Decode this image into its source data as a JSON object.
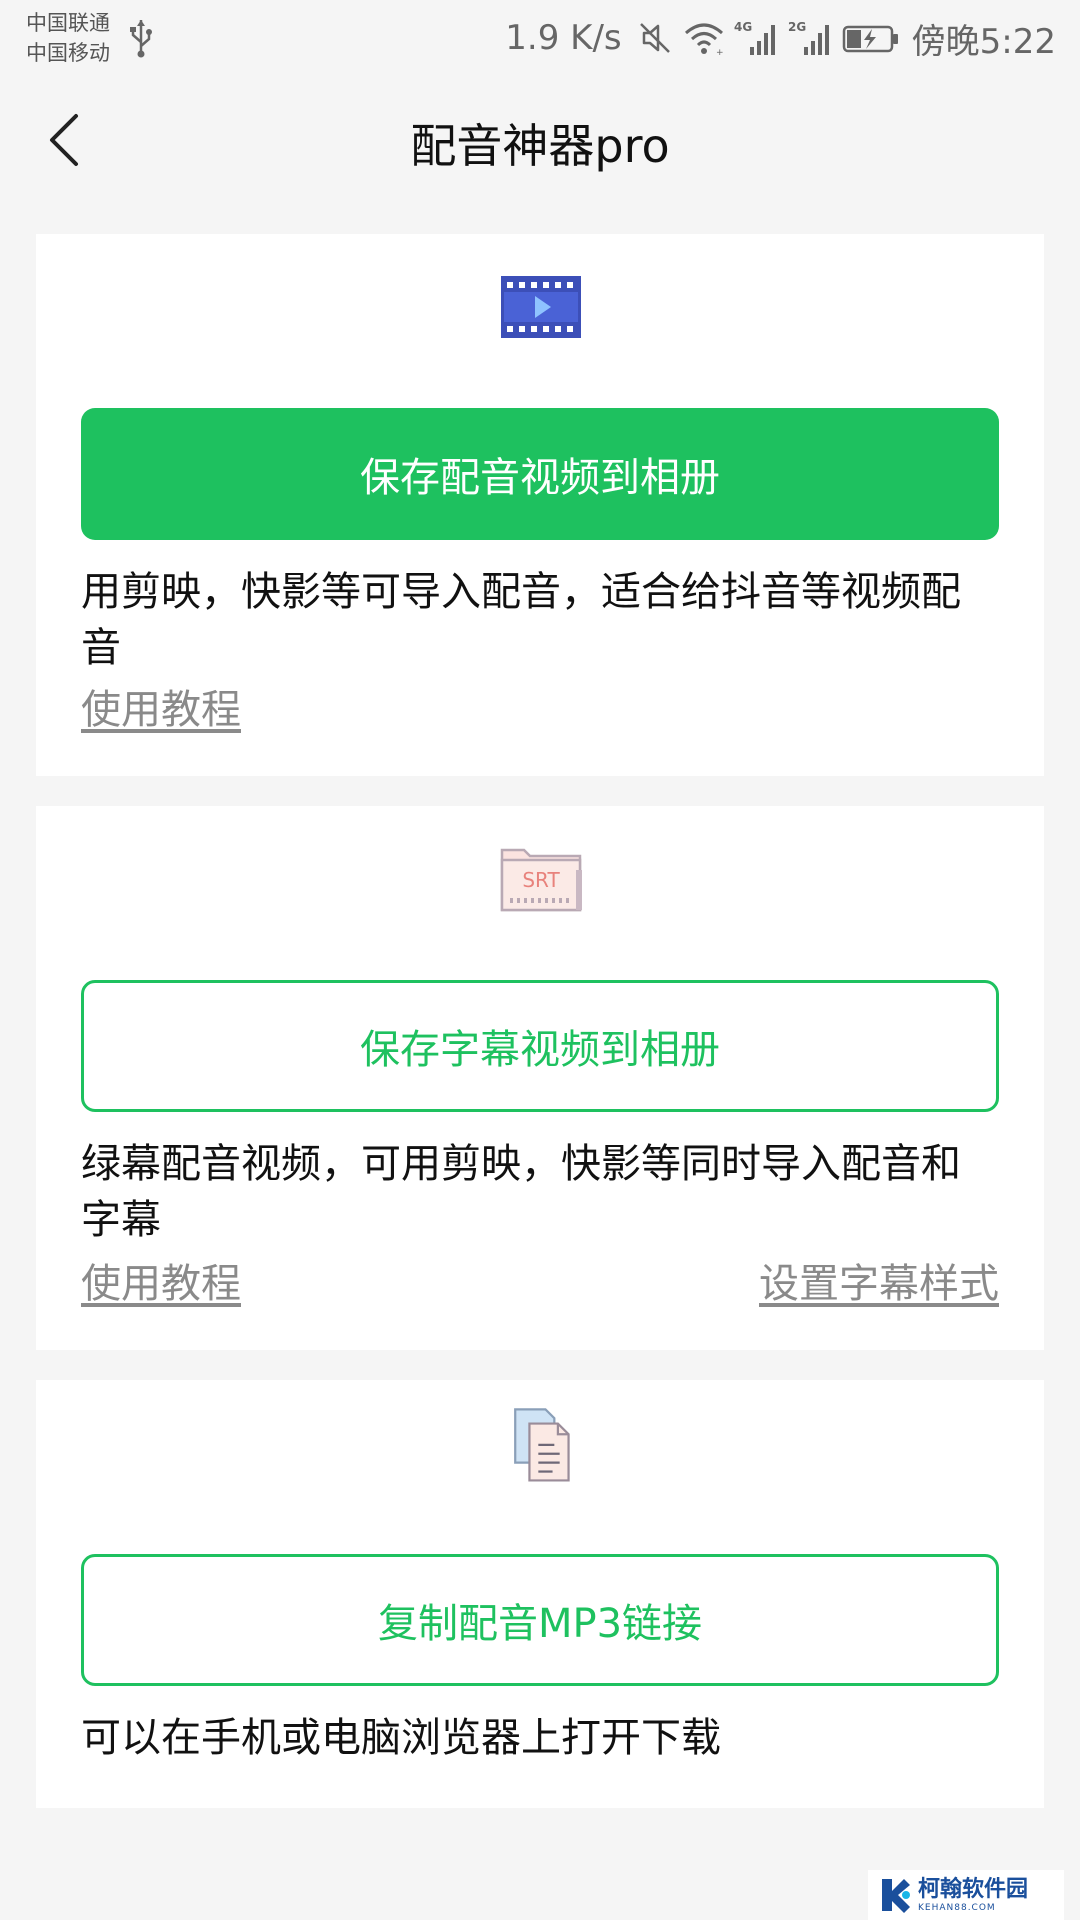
{
  "status_bar": {
    "carrier_1": "中国联通",
    "carrier_2": "中国移动",
    "net_speed": "1.9 K/s",
    "time": "傍晚5:22",
    "signal_1_label": "4G",
    "signal_2_label": "2G",
    "icons": [
      "usb-icon",
      "mute-icon",
      "wifi-icon",
      "signal-4g-icon",
      "signal-2g-icon",
      "battery-charging-icon"
    ]
  },
  "nav": {
    "title": "配音神器pro",
    "back_icon": "back-arrow-icon"
  },
  "cards": [
    {
      "icon": "video-film-icon",
      "button_label": "保存配音视频到相册",
      "button_style": "primary",
      "description": "用剪映，快影等可导入配音，适合给抖音等视频配音",
      "link_left": "使用教程"
    },
    {
      "icon": "srt-subtitle-icon",
      "icon_text": "SRT",
      "button_label": "保存字幕视频到相册",
      "button_style": "outline",
      "description": "绿幕配音视频，可用剪映，快影等同时导入配音和字幕",
      "link_left": "使用教程",
      "link_right": "设置字幕样式"
    },
    {
      "icon": "copy-document-icon",
      "button_label": "复制配音MP3链接",
      "button_style": "outline",
      "description": "可以在手机或电脑浏览器上打开下载"
    }
  ],
  "colors": {
    "accent": "#1ec15f",
    "background": "#f5f5f5",
    "card": "#ffffff",
    "link": "#8a8a8a"
  },
  "watermark": {
    "name": "柯翰软件园",
    "sub": "KEHAN88.COM"
  }
}
